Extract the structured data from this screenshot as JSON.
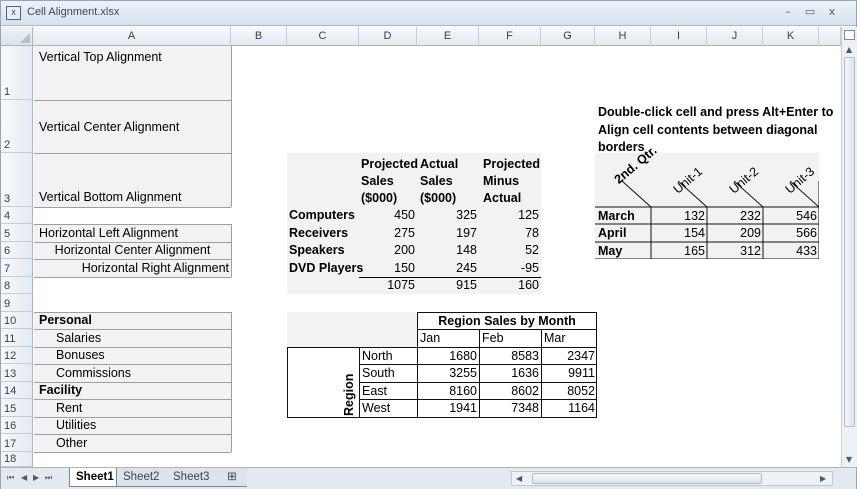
{
  "window": {
    "title": "Cell Alignment.xlsx",
    "minimize_glyph": "–",
    "restore_glyph": "▭",
    "close_glyph": "x"
  },
  "columns": [
    "A",
    "B",
    "C",
    "D",
    "E",
    "F",
    "G",
    "H",
    "I",
    "J",
    "K"
  ],
  "rows": [
    "1",
    "2",
    "3",
    "4",
    "5",
    "6",
    "7",
    "8",
    "9",
    "10",
    "11",
    "12",
    "13",
    "14",
    "15",
    "16",
    "17",
    "18"
  ],
  "column_a": {
    "r1": "Vertical Top Alignment",
    "r2": "Vertical Center Alignment",
    "r3": "Vertical Bottom Alignment",
    "r5": "Horizontal Left Alignment",
    "r6": "Horizontal Center Alignment",
    "r7": "Horizontal Right Alignment",
    "r10": "Personal",
    "r11": "Salaries",
    "r12": "Bonuses",
    "r13": "Commissions",
    "r14": "Facility",
    "r15": "Rent",
    "r16": "Utilities",
    "r17": "Other"
  },
  "sales_table": {
    "headers": [
      [
        "Projected",
        "Sales",
        "($000)"
      ],
      [
        "Actual",
        "Sales",
        "($000)"
      ],
      [
        "Projected",
        "Minus",
        "Actual"
      ]
    ],
    "rows": [
      {
        "label": "Computers",
        "values": [
          "450",
          "325",
          "125"
        ]
      },
      {
        "label": "Receivers",
        "values": [
          "275",
          "197",
          "78"
        ]
      },
      {
        "label": "Speakers",
        "values": [
          "200",
          "148",
          "52"
        ]
      },
      {
        "label": "DVD Players",
        "values": [
          "150",
          "245",
          "-95"
        ]
      }
    ],
    "totals": [
      "1075",
      "915",
      "160"
    ]
  },
  "note": {
    "line1": "Double-click cell and press Alt+Enter to",
    "line2": "Align cell contents between diagonal",
    "line3": "borders"
  },
  "unit_table": {
    "corner": "2nd. Qtr.",
    "headers": [
      "Unit-1",
      "Unit-2",
      "Unit-3"
    ],
    "rows": [
      {
        "label": "March",
        "values": [
          "132",
          "232",
          "546"
        ]
      },
      {
        "label": "April",
        "values": [
          "154",
          "209",
          "566"
        ]
      },
      {
        "label": "May",
        "values": [
          "165",
          "312",
          "433"
        ]
      }
    ]
  },
  "region_table": {
    "title": "Region Sales by Month",
    "months": [
      "Jan",
      "Feb",
      "Mar"
    ],
    "side_label": "Region",
    "rows": [
      {
        "label": "North",
        "values": [
          "1680",
          "8583",
          "2347"
        ]
      },
      {
        "label": "South",
        "values": [
          "3255",
          "1636",
          "9911"
        ]
      },
      {
        "label": "East",
        "values": [
          "8160",
          "8602",
          "8052"
        ]
      },
      {
        "label": "West",
        "values": [
          "1941",
          "7348",
          "1164"
        ]
      }
    ]
  },
  "sheet_tabs": [
    "Sheet1",
    "Sheet2",
    "Sheet3"
  ],
  "active_tab": "Sheet1",
  "nav_glyphs": {
    "first": "⏮",
    "prev": "◀",
    "next": "▶",
    "last": "⏭"
  }
}
